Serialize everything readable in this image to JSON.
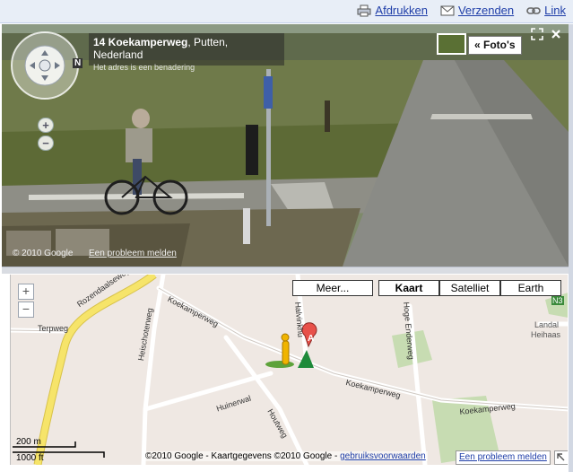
{
  "topbar": {
    "print_label": "Afdrukken",
    "send_label": "Verzenden",
    "link_label": "Link"
  },
  "streetview": {
    "address_main": "14 Koekamperweg",
    "address_place": ", Putten, Nederland",
    "address_note": "Het adres is een benadering",
    "photos_label": "« Foto's",
    "copyright": "© 2010 Google",
    "report_label": "Een probleem melden",
    "zoom_in": "+",
    "zoom_out": "−",
    "compass_letter": "N"
  },
  "map": {
    "types": [
      "Meer...",
      "Kaart",
      "Satelliet",
      "Earth"
    ],
    "active_type": "Kaart",
    "zoom_in": "+",
    "zoom_out": "−",
    "scale_metric": "200 m",
    "scale_imperial": "1000 ft",
    "copyright": "©2010 Google - Kaartgegevens ©2010 Google - ",
    "terms_link": "gebruiksvoorwaarden",
    "report_label": "Een probleem melden",
    "marker_label": "A",
    "road_labels": {
      "rozendaalseweg": "Rozendaalseweg",
      "terpweg": "Terpweg",
      "heischoterweg": "Heischoterweg",
      "koekamperweg": "Koekamperweg",
      "halvinkhuisweg": "Halvinkhu",
      "hoge_enderweg": "Hoge Enderweg",
      "huinerwal": "Huinerwal",
      "houtweg": "Houtweg",
      "n3": "N3",
      "landal": "Landal",
      "heihaas": "Heihaas"
    }
  },
  "colors": {
    "link": "#1f3ea8",
    "map_bg": "#efe8e3",
    "highway": "#f6e46a",
    "park": "#c7dcb2",
    "marker": "#e8514a",
    "pegman": "#f0b400"
  }
}
